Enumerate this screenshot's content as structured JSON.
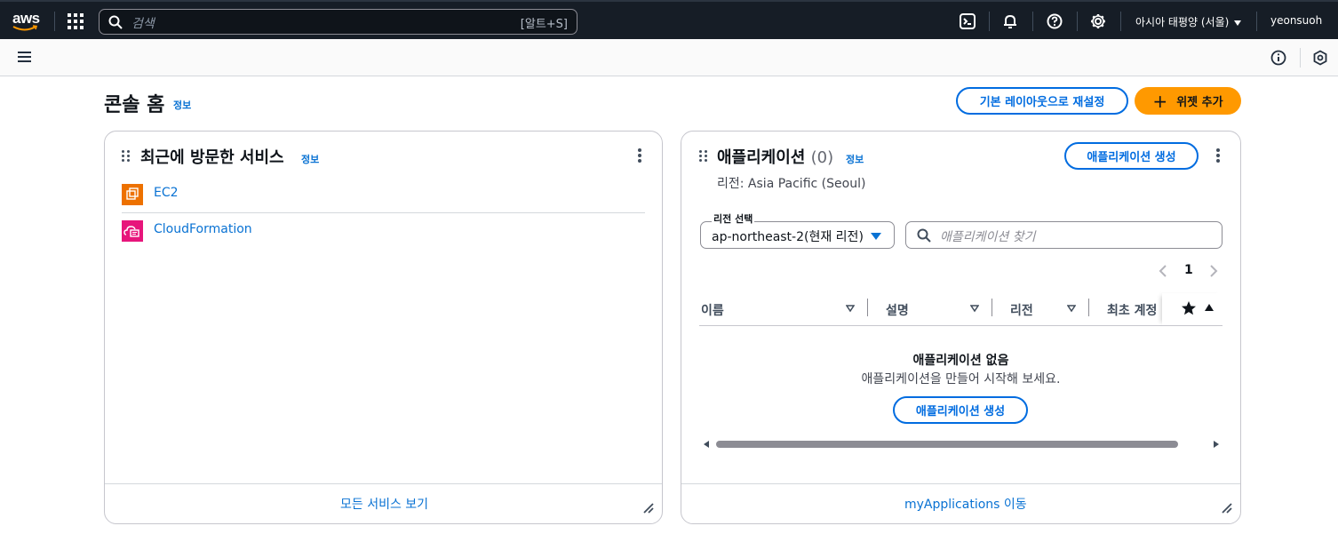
{
  "topnav": {
    "logo": "aws",
    "search_placeholder": "검색",
    "search_shortcut": "[알트+S]",
    "region": "아시아 태평양 (서울)",
    "user": "yeonsuoh",
    "icons": [
      "grid-icon",
      "search-icon",
      "cloudshell-icon",
      "bell-icon",
      "help-icon",
      "settings-icon"
    ]
  },
  "subbar": {
    "icons": [
      "menu-icon",
      "info-icon",
      "feedback-icon"
    ]
  },
  "page": {
    "title": "콘솔 홈",
    "info": "정보",
    "reset_button": "기본 레이아웃으로 재설정",
    "add_widget_button": "위젯 추가"
  },
  "recent_services": {
    "title": "최근에 방문한 서비스",
    "info": "정보",
    "items": [
      {
        "name": "EC2",
        "color": "#ed7100"
      },
      {
        "name": "CloudFormation",
        "color": "#e7157b"
      }
    ],
    "footer_link": "모든 서비스 보기"
  },
  "applications": {
    "title": "애플리케이션",
    "count": "(0)",
    "info": "정보",
    "create_button": "애플리케이션 생성",
    "region_text": "리전: Asia Pacific (Seoul)",
    "region_select_label": "리전 선택",
    "region_select_value": "ap-northeast-2(현재 리전)",
    "search_placeholder": "애플리케이션 찾기",
    "page_number": "1",
    "columns": [
      "이름",
      "설명",
      "리전",
      "최초 계정"
    ],
    "empty_title": "애플리케이션 없음",
    "empty_sub": "애플리케이션을 만들어 시작해 보세요.",
    "empty_create_button": "애플리케이션 생성",
    "footer_link": "myApplications 이동"
  },
  "colors": {
    "nav_bg": "#161d26",
    "link": "#0972d3",
    "primary_button": "#ff9900"
  }
}
